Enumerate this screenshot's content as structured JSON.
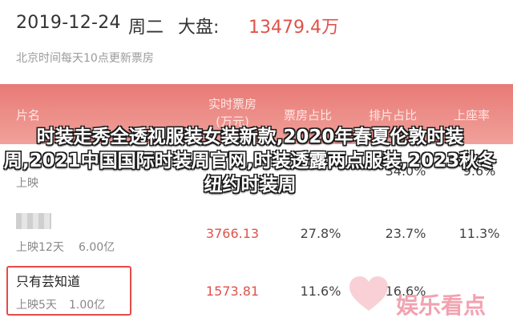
{
  "header": {
    "date": "2019-12-24",
    "weekday": "周二",
    "market_label": "大盘:",
    "market_value": "13479.4万",
    "note": "北京时间每天10点更新票房"
  },
  "table": {
    "headers": {
      "name": "片名",
      "live_line1": "实时票房",
      "live_line2": "(万元)",
      "share": "票房占比",
      "schedule": "排片占比",
      "seat": "上座率"
    },
    "rows": [
      {
        "title": "",
        "days": "上映",
        "total": "",
        "live": "",
        "share": "",
        "schedule": "34.0%",
        "seat": "9.6%"
      },
      {
        "title": "",
        "days": "上映12天",
        "total": "6.00亿",
        "live": "3766.13",
        "share": "27.8%",
        "schedule": "23.7%",
        "seat": "11.3%"
      },
      {
        "title": "只有芸知道",
        "days": "上映5天",
        "total": "1.00亿",
        "live": "1573.81",
        "share": "11.6%",
        "schedule": "16.6%",
        "seat": ""
      }
    ]
  },
  "overlay_text": "时装走秀全透视服装女装新款,2020年春夏伦敦时装周,2021中国国际时装周官网,时装透露两点服装,2023秋冬纽约时装周",
  "watermark": {
    "text": "娱乐看点",
    "color": "#f2a2b0"
  },
  "colors": {
    "accent": "#e0524a",
    "header_band": "#e87a75"
  }
}
